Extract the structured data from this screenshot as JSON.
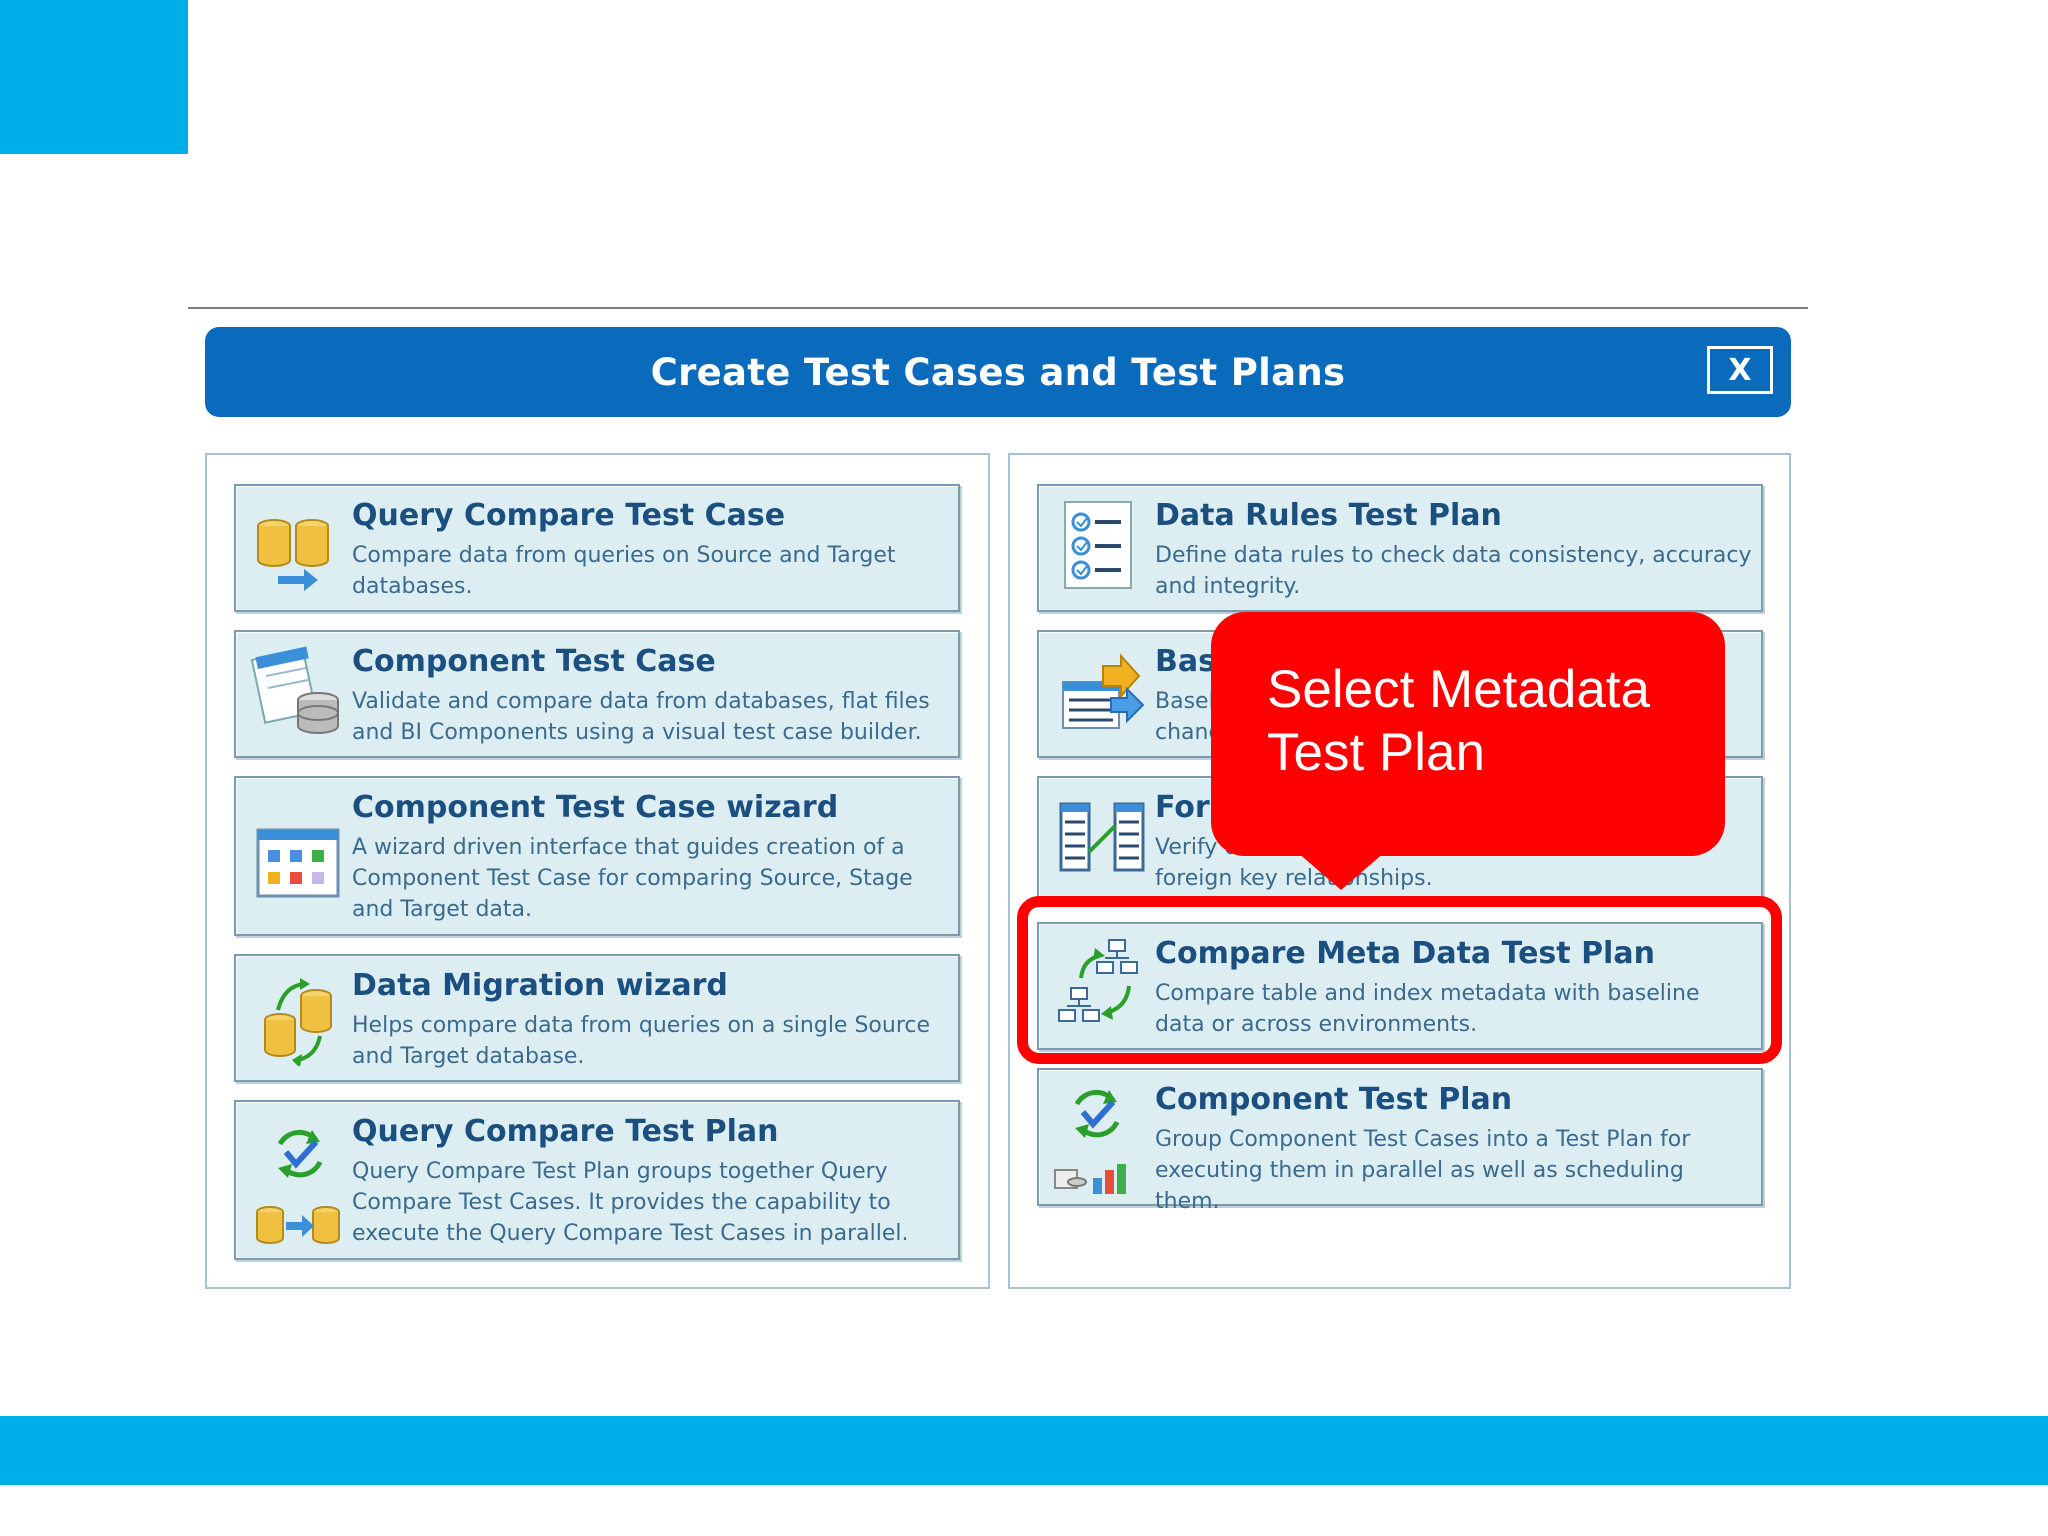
{
  "dialog": {
    "title": "Create Test Cases and Test Plans",
    "close_label": "X"
  },
  "left_items": [
    {
      "title": "Query Compare Test Case",
      "desc": "Compare data from queries on Source and Target databases.",
      "icon": "database-compare-icon"
    },
    {
      "title": "Component Test Case",
      "desc": "Validate and compare data from databases, flat files and BI Components using a visual test case builder.",
      "icon": "component-test-case-icon"
    },
    {
      "title": "Component Test Case wizard",
      "desc": "A wizard driven interface that guides creation of a Component Test Case for comparing Source, Stage and Target data.",
      "icon": "wizard-grid-icon"
    },
    {
      "title": "Data Migration wizard",
      "desc": "Helps compare data from queries on a single Source and Target database.",
      "icon": "data-migration-icon"
    },
    {
      "title": "Query Compare Test Plan",
      "desc": "Query Compare Test Plan groups together Query Compare Test Cases. It provides the capability to execute the Query Compare Test Cases in parallel.",
      "icon": "query-compare-plan-icon"
    }
  ],
  "right_items": [
    {
      "title": "Data Rules Test Plan",
      "desc": "Define data rules to check data consistency, accuracy and integrity.",
      "icon": "checklist-icon"
    },
    {
      "title": "Bas",
      "desc": "Basel\nchang",
      "icon": "baseline-icon"
    },
    {
      "title": "Fore",
      "desc": "Verify d\nforeign key relationships.",
      "icon": "foreign-key-icon"
    },
    {
      "title": "Compare Meta Data Test Plan",
      "desc": "Compare table and index metadata with baseline data or across environments.",
      "icon": "metadata-compare-icon"
    },
    {
      "title": "Component Test Plan",
      "desc": "Group Component Test Cases into a Test Plan for executing them in parallel as well as scheduling them.",
      "icon": "component-test-plan-icon"
    }
  ],
  "callout": {
    "text": "Select Metadata\nTest Plan"
  },
  "colors": {
    "accent": "#00aeea",
    "header": "#0a6abb",
    "highlight": "#ff0000",
    "card_bg": "#ddeef2",
    "title_text": "#1b4f80"
  }
}
